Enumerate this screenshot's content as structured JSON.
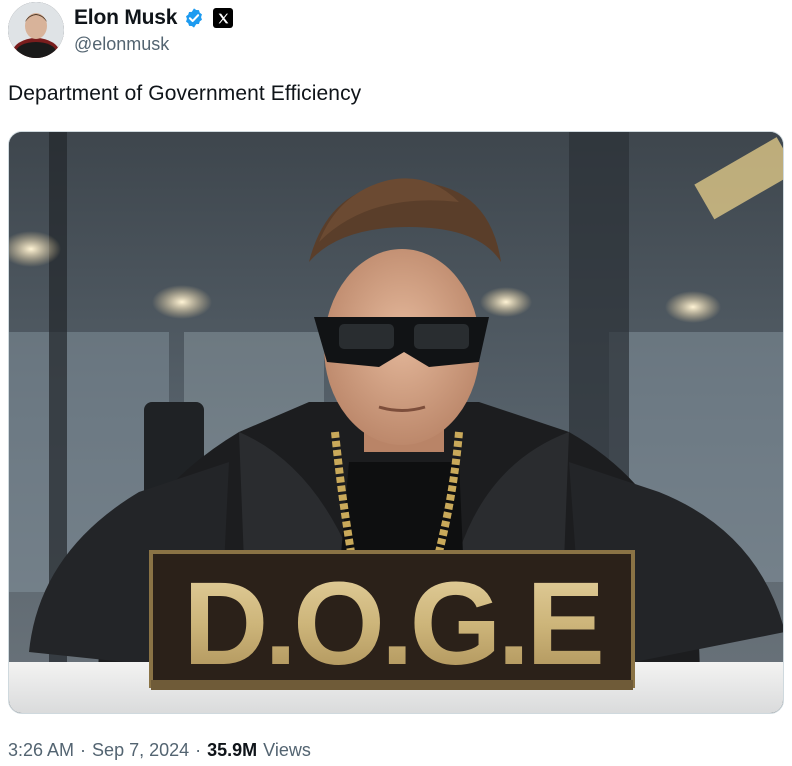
{
  "author": {
    "display_name": "Elon Musk",
    "handle": "@elonmusk",
    "verified": true,
    "verified_color": "#1d9bf0",
    "affiliation_badge": "x-logo-icon"
  },
  "tweet": {
    "text": "Department of Government Efficiency"
  },
  "media": {
    "sign_text": "D.O.G.E"
  },
  "meta": {
    "time": "3:26 AM",
    "separator": "·",
    "date": "Sep 7, 2024",
    "views_count": "35.9M",
    "views_label": "Views"
  }
}
